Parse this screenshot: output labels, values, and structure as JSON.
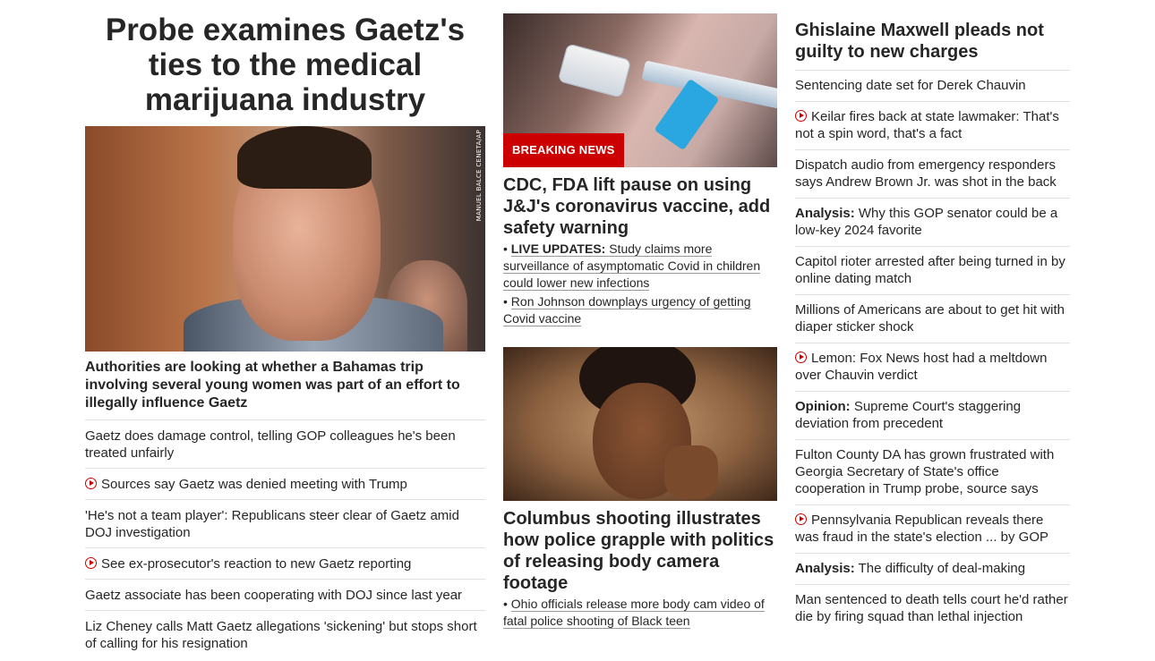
{
  "left": {
    "headline": "Probe examines Gaetz's ties to the medical marijuana industry",
    "photo_credit": "MANUEL BALCE CENETA/AP",
    "sub_headline": "Authorities are looking at whether a Bahamas trip involving several young women was part of an effort to illegally influence Gaetz",
    "items": [
      {
        "text": "Gaetz does damage control, telling GOP colleagues he's been treated unfairly",
        "video": false
      },
      {
        "text": "Sources say Gaetz was denied meeting with Trump",
        "video": true
      },
      {
        "text": "'He's not a team player': Republicans steer clear of Gaetz amid DOJ investigation",
        "video": false
      },
      {
        "text": "See ex-prosecutor's reaction to new Gaetz reporting",
        "video": true
      },
      {
        "text": "Gaetz associate has been cooperating with DOJ since last year",
        "video": false
      },
      {
        "text": "Liz Cheney calls Matt Gaetz allegations 'sickening' but stops short of calling for his resignation",
        "video": false
      }
    ]
  },
  "middle": {
    "breaking_label": "BREAKING NEWS",
    "story1": {
      "headline": "CDC, FDA lift pause on using J&J's coronavirus vaccine, add safety warning",
      "links": [
        {
          "label": "LIVE UPDATES:",
          "text": "Study claims more surveillance of asymptomatic Covid in children could lower new infections"
        },
        {
          "label": "",
          "text": "Ron Johnson downplays urgency of getting Covid vaccine"
        }
      ]
    },
    "story2": {
      "headline": "Columbus shooting illustrates how police grapple with politics of releasing body camera footage",
      "links": [
        {
          "label": "",
          "text": "Ohio officials release more body cam video of fatal police shooting of Black teen"
        }
      ]
    }
  },
  "right": {
    "headline": "Ghislaine Maxwell pleads not guilty to new charges",
    "items": [
      {
        "prefix": "",
        "text": "Sentencing date set for Derek Chauvin",
        "video": false
      },
      {
        "prefix": "",
        "text": "Keilar fires back at state lawmaker: That's not a spin word, that's a fact",
        "video": true
      },
      {
        "prefix": "",
        "text": "Dispatch audio from emergency responders says Andrew Brown Jr. was shot in the back",
        "video": false
      },
      {
        "prefix": "Analysis:",
        "text": "Why this GOP senator could be a low-key 2024 favorite",
        "video": false
      },
      {
        "prefix": "",
        "text": "Capitol rioter arrested after being turned in by online dating match",
        "video": false
      },
      {
        "prefix": "",
        "text": "Millions of Americans are about to get hit with diaper sticker shock",
        "video": false
      },
      {
        "prefix": "",
        "text": "Lemon: Fox News host had a meltdown over Chauvin verdict",
        "video": true
      },
      {
        "prefix": "Opinion:",
        "text": "Supreme Court's staggering deviation from precedent",
        "video": false
      },
      {
        "prefix": "",
        "text": "Fulton County DA has grown frustrated with Georgia Secretary of State's office cooperation in Trump probe, source says",
        "video": false
      },
      {
        "prefix": "",
        "text": "Pennsylvania Republican reveals there was fraud in the state's election ... by GOP",
        "video": true
      },
      {
        "prefix": "Analysis:",
        "text": "The difficulty of deal-making",
        "video": false
      },
      {
        "prefix": "",
        "text": "Man sentenced to death tells court he'd rather die by firing squad than lethal injection",
        "video": false
      }
    ]
  },
  "colors": {
    "accent_red": "#cc0000",
    "text": "#262626",
    "divider": "#e0e0e0"
  }
}
